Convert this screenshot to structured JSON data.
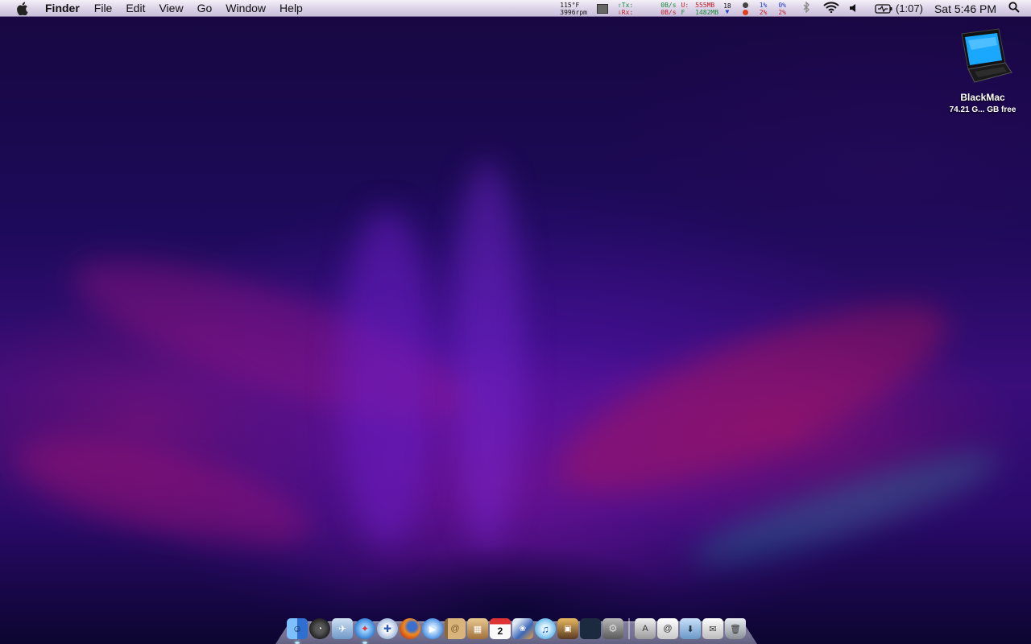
{
  "menubar": {
    "app_name": "Finder",
    "menus": [
      "File",
      "Edit",
      "View",
      "Go",
      "Window",
      "Help"
    ],
    "status": {
      "temperature": "115°F",
      "fan_speed": "3996rpm",
      "net_tx_label": "Tx:",
      "net_rx_label": "Rx:",
      "net_tx_rate": "0B/s",
      "net_rx_rate": "0B/s",
      "mem_used_label": "U:",
      "mem_free_label": "F",
      "mem_used": "555MB",
      "mem_free": "1482MB",
      "disk_count": "18",
      "cpu1_user": "1%",
      "cpu1_sys": "2%",
      "cpu2_user": "0%",
      "cpu2_sys": "2%",
      "battery_time": "(1:07)",
      "clock": "Sat 5:46 PM"
    }
  },
  "desktop": {
    "disk_icon": {
      "name": "BlackMac",
      "info": "74.21 G... GB free"
    }
  },
  "dock": {
    "apps": [
      {
        "name": "finder-icon",
        "color": "#3a86e0",
        "running": true
      },
      {
        "name": "dashboard-icon",
        "color": "#333333",
        "running": false
      },
      {
        "name": "mail-icon",
        "color": "#7aa8d8",
        "running": false
      },
      {
        "name": "safari-icon",
        "color": "#4f9be0",
        "running": true
      },
      {
        "name": "network-utility-icon",
        "color": "#d8e2f0",
        "running": false
      },
      {
        "name": "firefox-icon",
        "color": "#e56a1c",
        "running": false
      },
      {
        "name": "ichat-icon",
        "color": "#5aa0e8",
        "running": false
      },
      {
        "name": "address-book-icon",
        "color": "#c49b5a",
        "running": false
      },
      {
        "name": "preview-icon",
        "color": "#b9854c",
        "running": false
      },
      {
        "name": "ical-icon",
        "color": "#f5f5f5",
        "running": false
      },
      {
        "name": "iphoto-icon",
        "color": "#5178b8",
        "running": false
      },
      {
        "name": "itunes-icon",
        "color": "#6dbce8",
        "running": false
      },
      {
        "name": "photo-booth-icon",
        "color": "#8a5a3a",
        "running": false
      },
      {
        "name": "spaces-icon",
        "color": "#486a98",
        "running": false
      },
      {
        "name": "system-preferences-icon",
        "color": "#7d7d7d",
        "running": false
      }
    ],
    "stacks": [
      {
        "name": "applications-stack-icon",
        "color": "#d8d8d8"
      },
      {
        "name": "documents-stack-icon",
        "color": "#e8e8e8"
      },
      {
        "name": "downloads-stack-icon",
        "color": "#9ec3e8"
      },
      {
        "name": "mail-stack-icon",
        "color": "#f0f0f0"
      },
      {
        "name": "trash-icon",
        "color": "#c0c4cc"
      }
    ],
    "calendar_day": "2"
  }
}
